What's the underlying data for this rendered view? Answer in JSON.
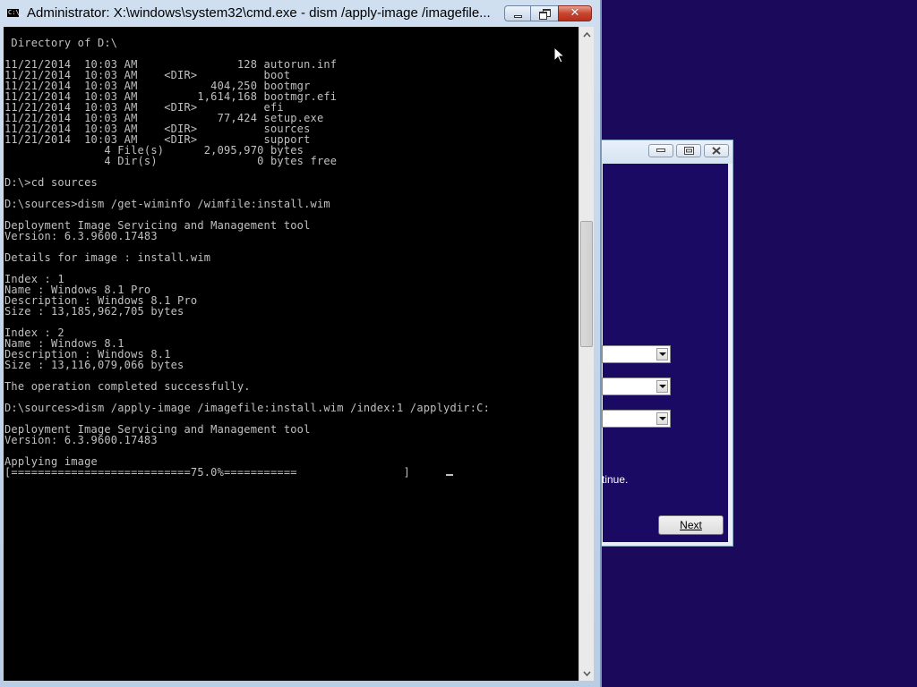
{
  "cmd_window": {
    "title": "Administrator: X:\\windows\\system32\\cmd.exe - dism  /apply-image /imagefile...",
    "icon_label": "C:\\_",
    "lines": [
      "",
      " Directory of D:\\",
      "",
      "11/21/2014  10:03 AM               128 autorun.inf",
      "11/21/2014  10:03 AM    <DIR>          boot",
      "11/21/2014  10:03 AM           404,250 bootmgr",
      "11/21/2014  10:03 AM         1,614,168 bootmgr.efi",
      "11/21/2014  10:03 AM    <DIR>          efi",
      "11/21/2014  10:03 AM            77,424 setup.exe",
      "11/21/2014  10:03 AM    <DIR>          sources",
      "11/21/2014  10:03 AM    <DIR>          support",
      "               4 File(s)      2,095,970 bytes",
      "               4 Dir(s)               0 bytes free",
      "",
      "D:\\>cd sources",
      "",
      "D:\\sources>dism /get-wiminfo /wimfile:install.wim",
      "",
      "Deployment Image Servicing and Management tool",
      "Version: 6.3.9600.17483",
      "",
      "Details for image : install.wim",
      "",
      "Index : 1",
      "Name : Windows 8.1 Pro",
      "Description : Windows 8.1 Pro",
      "Size : 13,185,962,705 bytes",
      "",
      "Index : 2",
      "Name : Windows 8.1",
      "Description : Windows 8.1",
      "Size : 13,116,079,066 bytes",
      "",
      "The operation completed successfully.",
      "",
      "D:\\sources>dism /apply-image /imagefile:install.wim /index:1 /applydir:C:",
      "",
      "Deployment Image Servicing and Management tool",
      "Version: 6.3.9600.17483",
      "",
      "Applying image",
      "[===========================75.0%===========                ]"
    ],
    "progress_percent": 75.0,
    "scroll_position_fraction": 0.36
  },
  "setup_window": {
    "continue_text": "tinue.",
    "next_label": "Next"
  },
  "colors": {
    "console_bg": "#000000",
    "console_fg": "#c0c0c0",
    "desktop_bg": "#1b0a5c"
  }
}
